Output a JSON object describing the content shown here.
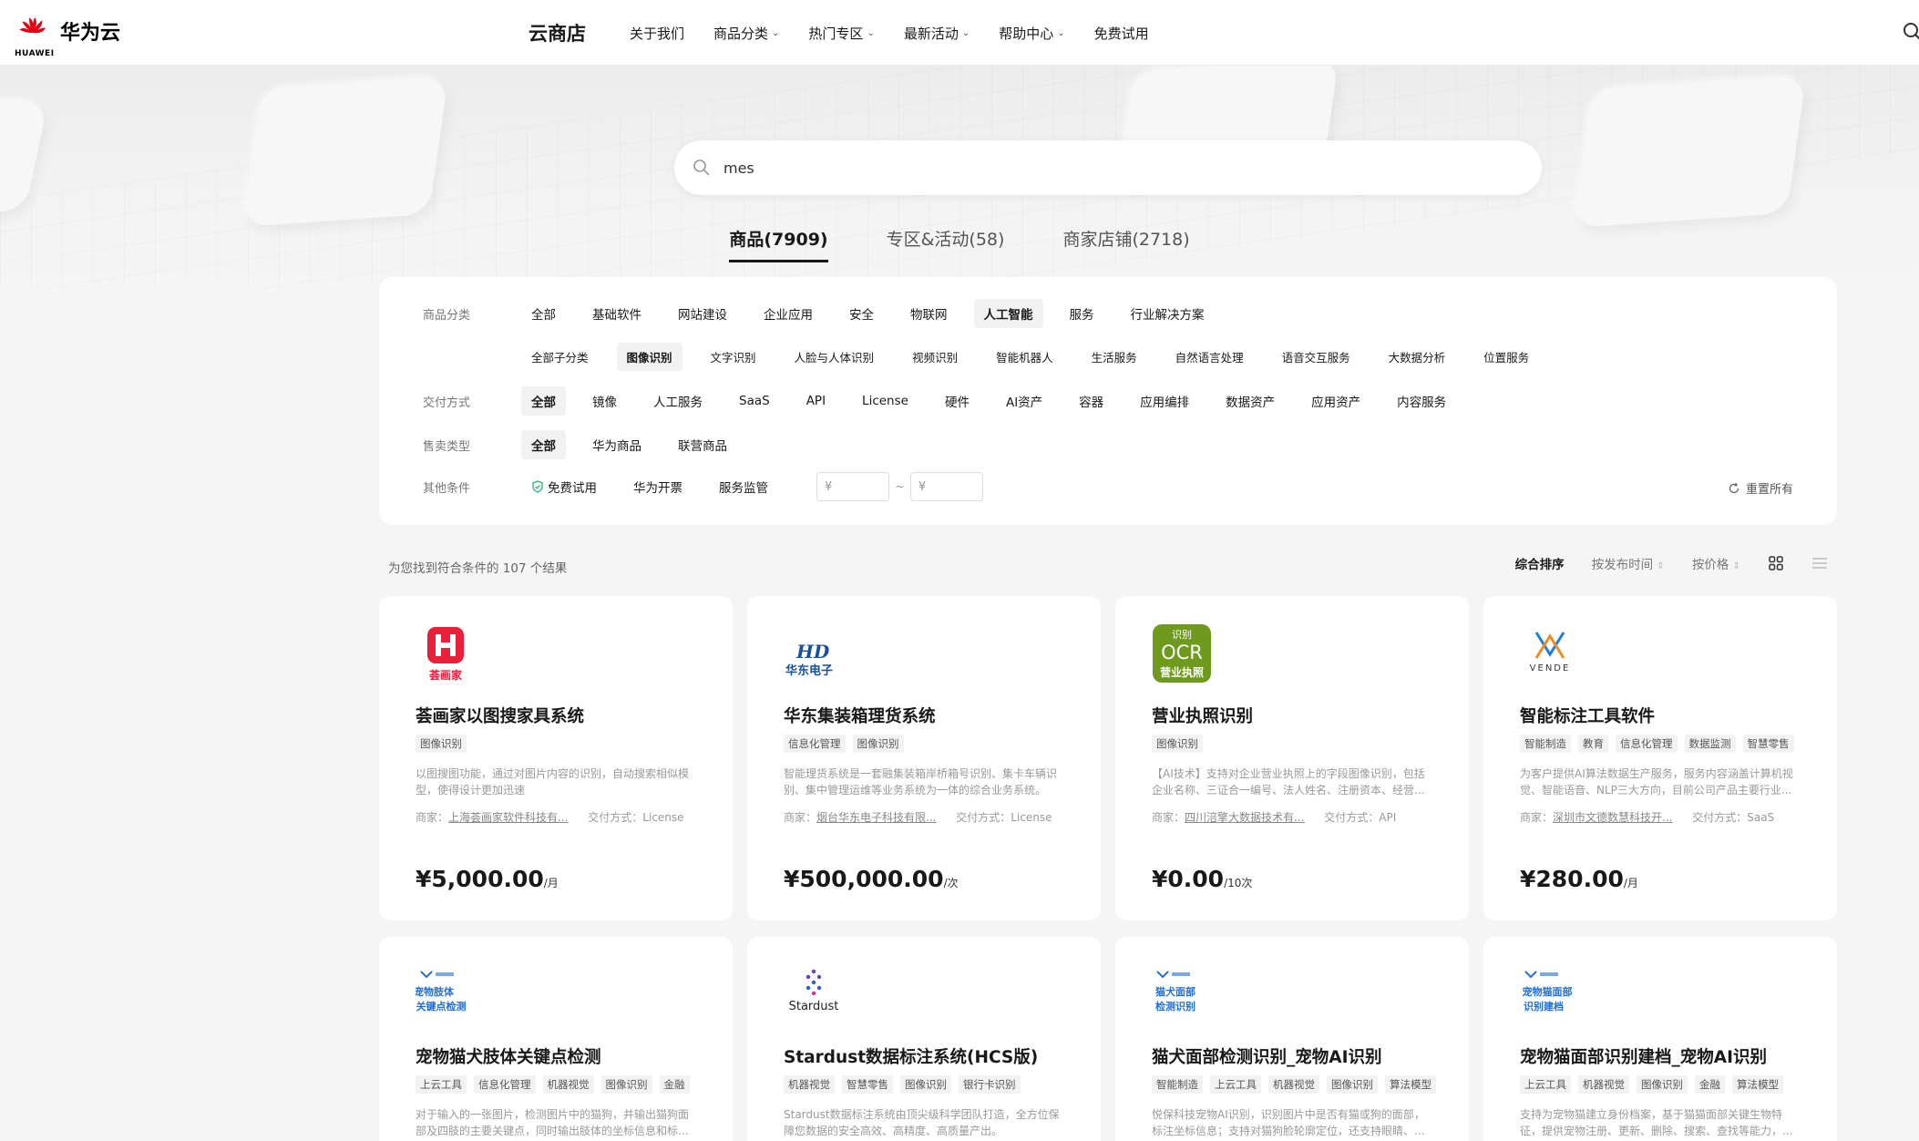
{
  "header": {
    "brand": "华为云",
    "brand_sub": "HUAWEI",
    "store_title": "云商店",
    "nav": [
      {
        "label": "关于我们",
        "has_menu": false
      },
      {
        "label": "商品分类",
        "has_menu": true
      },
      {
        "label": "热门专区",
        "has_menu": true
      },
      {
        "label": "最新活动",
        "has_menu": true
      },
      {
        "label": "帮助中心",
        "has_menu": true
      },
      {
        "label": "免费试用",
        "has_menu": false
      }
    ]
  },
  "search": {
    "value": "mes"
  },
  "tabs": [
    {
      "label": "商品(7909)",
      "active": true
    },
    {
      "label": "专区&活动(58)",
      "active": false
    },
    {
      "label": "商家店铺(2718)",
      "active": false
    }
  ],
  "filters": {
    "category": {
      "label": "商品分类",
      "options": [
        "全部",
        "基础软件",
        "网站建设",
        "企业应用",
        "安全",
        "物联网",
        "人工智能",
        "服务",
        "行业解决方案"
      ],
      "selected": "人工智能"
    },
    "subcategory": {
      "options": [
        "全部子分类",
        "图像识别",
        "文字识别",
        "人脸与人体识别",
        "视频识别",
        "智能机器人",
        "生活服务",
        "自然语言处理",
        "语音交互服务",
        "大数据分析",
        "位置服务"
      ],
      "selected": "图像识别"
    },
    "delivery": {
      "label": "交付方式",
      "options": [
        "全部",
        "镜像",
        "人工服务",
        "SaaS",
        "API",
        "License",
        "硬件",
        "AI资产",
        "容器",
        "应用编排",
        "数据资产",
        "应用资产",
        "内容服务"
      ],
      "selected": "全部"
    },
    "sale_type": {
      "label": "售卖类型",
      "options": [
        "全部",
        "华为商品",
        "联营商品"
      ],
      "selected": "全部"
    },
    "other": {
      "label": "其他条件",
      "free_trial": "免费试用",
      "invoice": "华为开票",
      "supervision": "服务监管",
      "price_min_placeholder": "¥",
      "price_max_placeholder": "¥",
      "tilde": "~"
    },
    "reset_label": "重置所有"
  },
  "results": {
    "count_text": "为您找到符合条件的 107 个结果",
    "sorts": [
      "综合排序",
      "按发布时间",
      "按价格"
    ],
    "active_sort": "综合排序"
  },
  "products": [
    {
      "title": "荟画家以图搜家具系统",
      "tags": [
        "图像识别"
      ],
      "desc": "以图搜图功能，通过对图片内容的识别，自动搜索相似模型，使得设计更加迅速",
      "seller_label": "商家：",
      "seller": "上海荟画家软件科技有...",
      "delivery": "交付方式：License",
      "price": "¥5,000.00",
      "unit": "/月",
      "logo": "huihuajia-logo",
      "logo_text": "荟画家"
    },
    {
      "title": "华东集装箱理货系统",
      "tags": [
        "信息化管理",
        "图像识别"
      ],
      "desc": "智能理货系统是一套融集装箱岸桥箱号识别、集卡车辆识别、集中管理运维等业务系统为一体的综合业务系统。",
      "seller_label": "商家：",
      "seller": "烟台华东电子科技有限...",
      "delivery": "交付方式：License",
      "price": "¥500,000.00",
      "unit": "/次",
      "logo": "huadong-logo",
      "logo_text": "华东电子"
    },
    {
      "title": "营业执照识别",
      "tags": [
        "图像识别"
      ],
      "desc": "【AI技术】支持对企业营业执照上的字段图像识别，包括企业名称、三证合一编号、法人姓名、注册资本、经营...",
      "seller_label": "商家：",
      "seller": "四川涪擎大数据技术有...",
      "delivery": "交付方式：API",
      "price": "¥0.00",
      "unit": "/10次",
      "logo": "ocr-logo",
      "logo_text": [
        "识别",
        "OCR",
        "营业执照"
      ]
    },
    {
      "title": "智能标注工具软件",
      "tags": [
        "智能制造",
        "教育",
        "信息化管理",
        "数据监测",
        "智慧零售"
      ],
      "desc": "为客户提供AI算法数据生产服务，服务内容涵盖计算机视觉、智能语音、NLP三大方向，目前公司产品主要行业...",
      "seller_label": "商家：",
      "seller": "深圳市文德数慧科技开...",
      "delivery": "交付方式：SaaS",
      "price": "¥280.00",
      "unit": "/月",
      "logo": "vende-logo",
      "logo_text": "VENDE"
    },
    {
      "title": "宠物猫犬肢体关键点检测",
      "tags": [
        "上云工具",
        "信息化管理",
        "机器视觉",
        "图像识别",
        "金融"
      ],
      "desc": "对于输入的一张图片，检测图片中的猫狗，并输出猫狗面部及四肢的主要关键点，同时输出肢体的坐标信息和标...",
      "logo": "pet-limb-logo",
      "logo_text": [
        "宠物肢体",
        "关键点检测"
      ]
    },
    {
      "title": "Stardust数据标注系统(HCS版)",
      "tags": [
        "机器视觉",
        "智慧零售",
        "图像识别",
        "银行卡识别"
      ],
      "desc": "Stardust数据标注系统由顶尖级科学团队打造，全方位保障您数据的安全高效、高精度、高质量产出。",
      "logo": "stardust-logo",
      "logo_text": "Stardust"
    },
    {
      "title": "猫犬面部检测识别_宠物AI识别",
      "tags": [
        "智能制造",
        "上云工具",
        "机器视觉",
        "图像识别",
        "算法模型"
      ],
      "desc": "悦保科技宠物AI识别，识别图片中是否有猫或狗的面部，标注坐标信息；支持对猫狗脸轮廓定位，还支持眼睛、...",
      "logo": "pet-face-logo",
      "logo_text": [
        "猫犬面部",
        "检测识别"
      ]
    },
    {
      "title": "宠物猫面部识别建档_宠物AI识别",
      "tags": [
        "上云工具",
        "机器视觉",
        "图像识别",
        "金融",
        "算法模型"
      ],
      "desc": "支持为宠物猫建立身份档案，基于猫猫面部关键生物特征，提供宠物注册、更新、删除、搜索、查找等能力，...",
      "logo": "cat-face-logo",
      "logo_text": [
        "宠物猫面部",
        "识别建档"
      ]
    }
  ],
  "colors": {
    "brand_red": "#e60012",
    "text": "#191919",
    "muted": "#999999",
    "panel": "#ffffff",
    "bg": "#f5f5f5",
    "ocr_green": "#6e9a1e",
    "huadong_blue": "#1a4fa0",
    "pet_blue": "#1f6fd8"
  }
}
